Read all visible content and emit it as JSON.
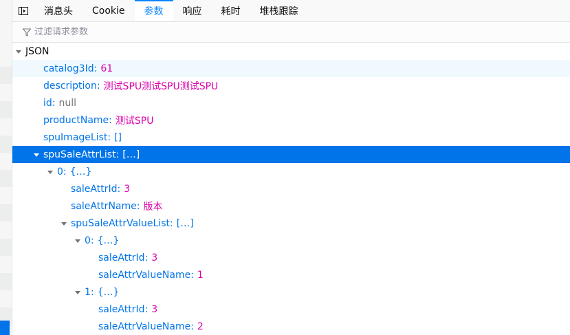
{
  "tabs": [
    {
      "label": "消息头",
      "active": false
    },
    {
      "label": "Cookie",
      "active": false
    },
    {
      "label": "参数",
      "active": true
    },
    {
      "label": "响应",
      "active": false
    },
    {
      "label": "耗时",
      "active": false
    },
    {
      "label": "堆栈跟踪",
      "active": false
    }
  ],
  "filter": {
    "placeholder": "过滤请求参数",
    "value": ""
  },
  "tree": {
    "root_label": "JSON",
    "rows": [
      {
        "key": "catalog3Id",
        "value": "61",
        "type": "number"
      },
      {
        "key": "description",
        "value": "测试SPU测试SPU测试SPU",
        "type": "string"
      },
      {
        "key": "id",
        "value": "null",
        "type": "null"
      },
      {
        "key": "productName",
        "value": "测试SPU",
        "type": "string"
      },
      {
        "key": "spuImageList",
        "value": "[]",
        "type": "object"
      },
      {
        "key": "spuSaleAttrList",
        "value": "[…]",
        "type": "object"
      },
      {
        "key": "0",
        "value": "{…}",
        "type": "object"
      },
      {
        "key": "saleAttrId",
        "value": "3",
        "type": "number"
      },
      {
        "key": "saleAttrName",
        "value": "版本",
        "type": "string"
      },
      {
        "key": "spuSaleAttrValueList",
        "value": "[…]",
        "type": "object"
      },
      {
        "key": "0",
        "value": "{…}",
        "type": "object"
      },
      {
        "key": "saleAttrId",
        "value": "3",
        "type": "number"
      },
      {
        "key": "saleAttrValueName",
        "value": "1",
        "type": "string"
      },
      {
        "key": "1",
        "value": "{…}",
        "type": "object"
      },
      {
        "key": "saleAttrId",
        "value": "3",
        "type": "number"
      },
      {
        "key": "saleAttrValueName",
        "value": "2",
        "type": "string"
      }
    ]
  },
  "colors": {
    "accent": "#0a84ff",
    "selection": "#0074e8",
    "key": "#0074e8",
    "value": "#dd00a9",
    "null": "#737373"
  },
  "icons": {
    "panel_toggle": "panel-toggle-icon",
    "filter": "filter-icon",
    "expander": "triangle-down-icon"
  }
}
